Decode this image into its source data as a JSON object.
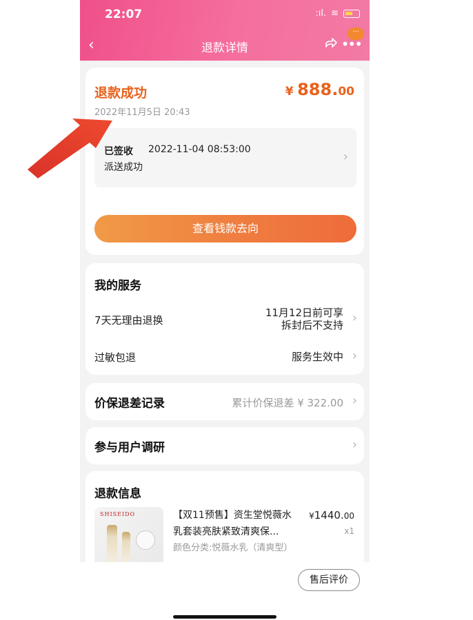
{
  "status_bar": {
    "time": "22:07",
    "signal": ":ıl.",
    "wifi": "≋"
  },
  "nav": {
    "back_icon": "chevron-left-icon",
    "title": "退款详情",
    "share_icon": "share-icon",
    "more_icon": "more-icon",
    "bubble": "···"
  },
  "refund": {
    "status": "退款成功",
    "amount_symbol": "¥",
    "amount_main": "888.",
    "amount_decimal": "00",
    "time": "2022年11月5日 20:43"
  },
  "logistics": {
    "status": "已签收",
    "time": "2022-11-04 08:53:00",
    "description": "派送成功"
  },
  "money_button": {
    "label": "查看钱款去向"
  },
  "services": {
    "title": "我的服务",
    "items": [
      {
        "label": "7天无理由退换",
        "value_line1": "11月12日前可享",
        "value_line2": "拆封后不支持"
      },
      {
        "label": "过敏包退",
        "value_line1": "服务生效中"
      }
    ]
  },
  "price_protection": {
    "label": "价保退差记录",
    "value": "累计价保退差 ¥ 322.00"
  },
  "survey": {
    "label": "参与用户调研"
  },
  "refund_info": {
    "title": "退款信息",
    "product": {
      "brand": "SHISEIDO",
      "name": "【双11预售】资生堂悦薇水乳套装亮肤紧致清爽保...",
      "spec": "颜色分类:悦薇水乳（清爽型）",
      "price_symbol": "¥",
      "price_main": "1440.",
      "price_decimal": "00",
      "quantity": "x1"
    }
  },
  "bottom": {
    "review_button": "售后评价"
  },
  "colors": {
    "accent": "#e8621c",
    "header": "#f0508a",
    "annotation": "#e8432d"
  }
}
